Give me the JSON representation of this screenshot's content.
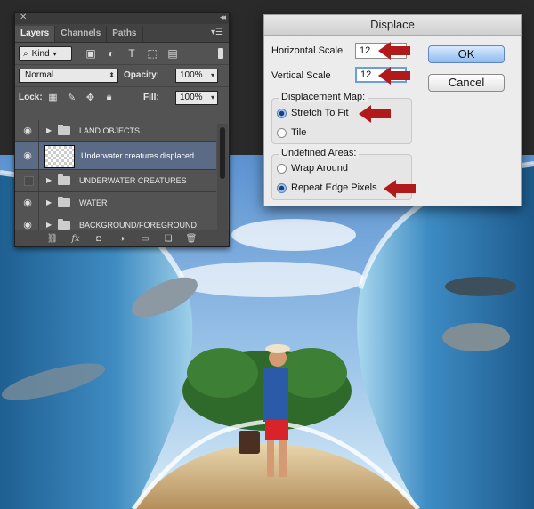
{
  "colors": {
    "arrow": "#b11a1a",
    "selection": "#5b6a85",
    "panel": "#535353",
    "dialog": "#ececec"
  },
  "layers_panel": {
    "close_icon": "x-icon",
    "collapse_icon": "double-chevron-icon",
    "tabs": [
      {
        "label": "Layers",
        "active": true
      },
      {
        "label": "Channels",
        "active": false
      },
      {
        "label": "Paths",
        "active": false
      }
    ],
    "filter": {
      "kind_label": "Kind",
      "icons": [
        "image-filter-icon",
        "adjustment-filter-icon",
        "type-filter-icon",
        "shape-filter-icon",
        "smart-object-filter-icon"
      ]
    },
    "blend_mode": "Normal",
    "opacity_label": "Opacity:",
    "opacity_value": "100%",
    "lock_label": "Lock:",
    "lock_icons": [
      "lock-transparent-icon",
      "lock-brush-icon",
      "lock-move-icon",
      "lock-all-icon"
    ],
    "fill_label": "Fill:",
    "fill_value": "100%",
    "layers": [
      {
        "name": "LAND OBJECTS",
        "type": "group",
        "visible": true,
        "selected": false
      },
      {
        "name": "Underwater creatures displaced",
        "type": "layer",
        "visible": true,
        "selected": true
      },
      {
        "name": "UNDERWATER CREATURES",
        "type": "group",
        "visible": false,
        "selected": false
      },
      {
        "name": "WATER",
        "type": "group",
        "visible": true,
        "selected": false
      },
      {
        "name": "BACKGROUND/FOREGROUND",
        "type": "group",
        "visible": true,
        "selected": false
      }
    ],
    "footer_icons": [
      "link-icon",
      "fx-icon",
      "mask-icon",
      "adjustment-icon",
      "folder-icon",
      "new-layer-icon",
      "trash-icon"
    ]
  },
  "displace_dialog": {
    "title": "Displace",
    "horizontal_scale_label": "Horizontal Scale",
    "horizontal_scale_value": "12",
    "vertical_scale_label": "Vertical Scale",
    "vertical_scale_value": "12",
    "ok_label": "OK",
    "cancel_label": "Cancel",
    "displacement_map": {
      "legend": "Displacement Map:",
      "options": [
        {
          "label": "Stretch To Fit",
          "selected": true
        },
        {
          "label": "Tile",
          "selected": false
        }
      ]
    },
    "undefined_areas": {
      "legend": "Undefined Areas:",
      "options": [
        {
          "label": "Wrap Around",
          "selected": false
        },
        {
          "label": "Repeat Edge Pixels",
          "selected": true
        }
      ]
    }
  }
}
